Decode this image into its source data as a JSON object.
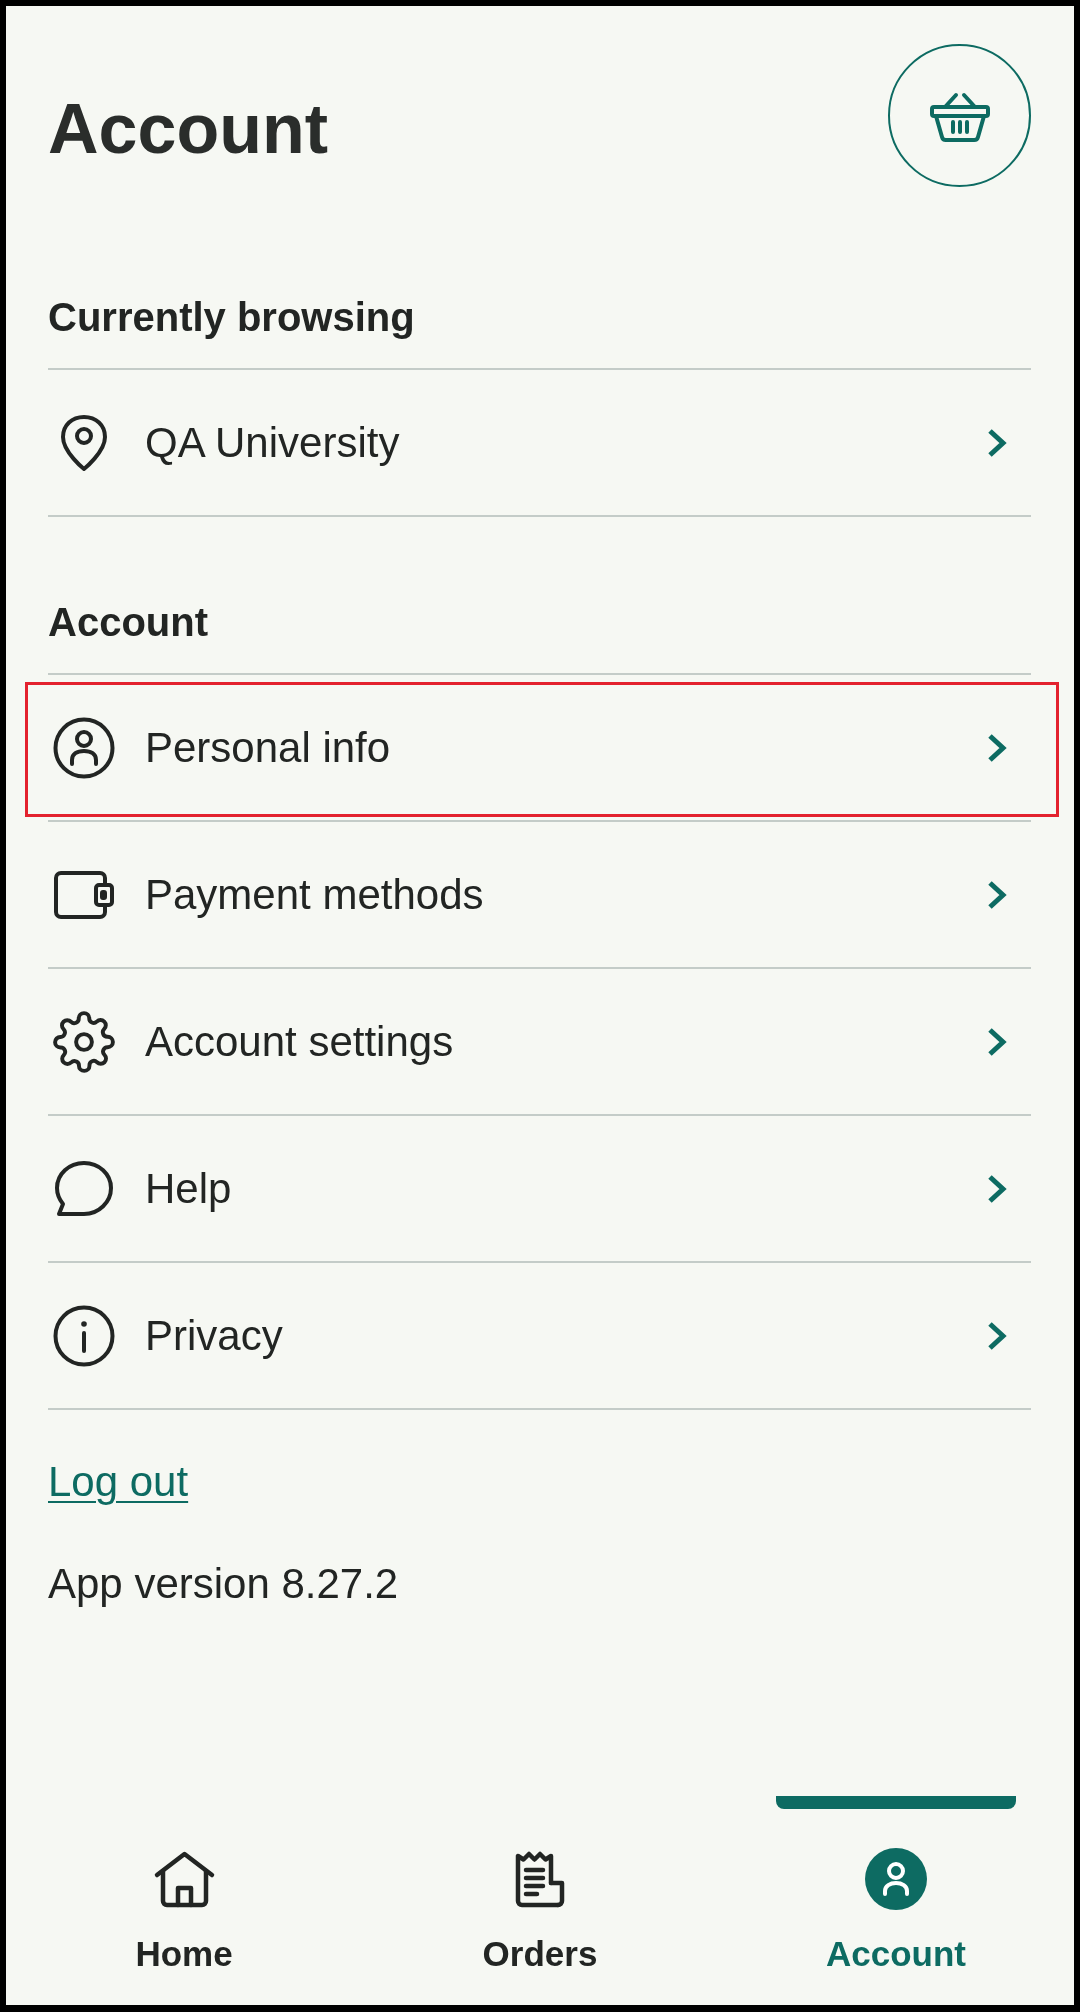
{
  "header": {
    "title": "Account"
  },
  "sections": [
    {
      "heading": "Currently browsing",
      "items": [
        {
          "label": "QA University",
          "highlighted": false
        }
      ]
    },
    {
      "heading": "Account",
      "items": [
        {
          "label": "Personal info",
          "highlighted": true
        },
        {
          "label": "Payment methods",
          "highlighted": false
        },
        {
          "label": "Account settings",
          "highlighted": false
        },
        {
          "label": "Help",
          "highlighted": false
        },
        {
          "label": "Privacy",
          "highlighted": false
        }
      ]
    }
  ],
  "logout_link": "Log out",
  "app_version": "App version 8.27.2",
  "bottom_nav": [
    {
      "label": "Home",
      "selected": false
    },
    {
      "label": "Orders",
      "selected": false
    },
    {
      "label": "Account",
      "selected": true
    }
  ]
}
